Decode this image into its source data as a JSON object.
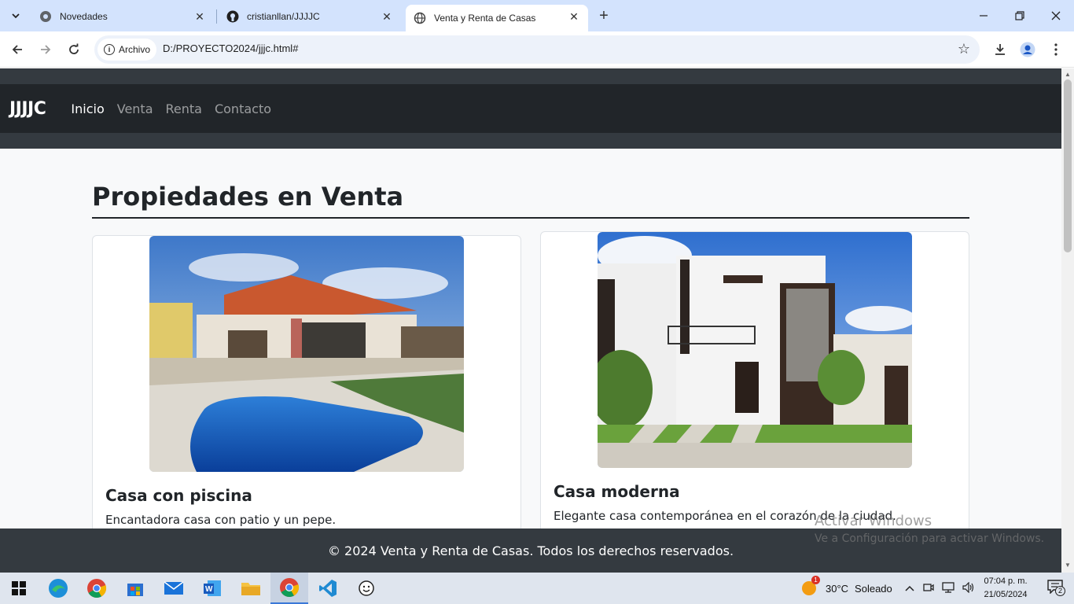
{
  "browser": {
    "tabs": [
      {
        "title": "Novedades",
        "active": false
      },
      {
        "title": "cristianllan/JJJJC",
        "active": false
      },
      {
        "title": "Venta y Renta de Casas",
        "active": true
      }
    ],
    "chip_label": "Archivo",
    "url": "D:/PROYECTO2024/jjjc.html#"
  },
  "site": {
    "brand": "JJJJC",
    "nav": [
      "Inicio",
      "Venta",
      "Renta",
      "Contacto"
    ],
    "section_title": "Propiedades en Venta",
    "cards": [
      {
        "title": "Casa con piscina",
        "text": "Encantadora casa con patio y un pepe."
      },
      {
        "title": "Casa moderna",
        "text": "Elegante casa contemporánea en el corazón de la ciudad."
      }
    ],
    "footer": "© 2024 Venta y Renta de Casas. Todos los derechos reservados."
  },
  "watermark": {
    "line1": "Activar Windows",
    "line2": "Ve a Configuración para activar Windows."
  },
  "taskbar": {
    "weather_temp": "30°C",
    "weather_text": "Soleado",
    "time": "07:04 p. m.",
    "date": "21/05/2024",
    "notif_count": "2",
    "weather_badge": "1"
  }
}
